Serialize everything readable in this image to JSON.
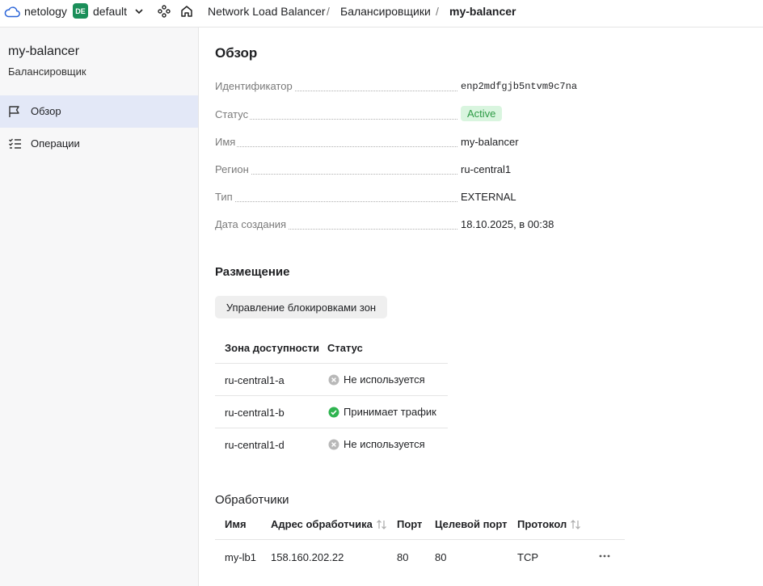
{
  "header": {
    "org": "netology",
    "folder_badge": "DE",
    "folder": "default",
    "breadcrumbs": [
      "Network Load Balancer",
      "Балансировщики",
      "my-balancer"
    ]
  },
  "sidebar": {
    "title": "my-balancer",
    "subtitle": "Балансировщик",
    "items": [
      {
        "label": "Обзор",
        "icon": "flag-icon",
        "active": true
      },
      {
        "label": "Операции",
        "icon": "operations-list-icon",
        "active": false
      }
    ]
  },
  "overview": {
    "title": "Обзор",
    "props": [
      {
        "label": "Идентификатор",
        "value": "enp2mdfgjb5ntvm9c7na"
      },
      {
        "label": "Статус",
        "value": "Active"
      },
      {
        "label": "Имя",
        "value": "my-balancer"
      },
      {
        "label": "Регион",
        "value": "ru-central1"
      },
      {
        "label": "Тип",
        "value": "EXTERNAL"
      },
      {
        "label": "Дата создания",
        "value": "18.10.2025, в 00:38"
      }
    ]
  },
  "placement": {
    "title": "Размещение",
    "button": "Управление блокировками зон",
    "columns": [
      "Зона доступности",
      "Статус"
    ],
    "rows": [
      {
        "zone": "ru-central1-a",
        "status": "Не используется",
        "state": "unused"
      },
      {
        "zone": "ru-central1-b",
        "status": "Принимает трафик",
        "state": "ok"
      },
      {
        "zone": "ru-central1-d",
        "status": "Не используется",
        "state": "unused"
      }
    ]
  },
  "listeners": {
    "title": "Обработчики",
    "columns": [
      "Имя",
      "Адрес обработчика",
      "Порт",
      "Целевой порт",
      "Протокол"
    ],
    "rows": [
      {
        "name": "my-lb1",
        "address": "158.160.202.22",
        "port": "80",
        "target_port": "80",
        "protocol": "TCP"
      }
    ]
  },
  "colors": {
    "active_bg": "#d9f5df",
    "active_text": "#2e9b46",
    "ok": "#2fb450",
    "unused": "#b8b8b8",
    "sidebar_active": "#e3e8f7",
    "badge": "#1b8f5a"
  }
}
